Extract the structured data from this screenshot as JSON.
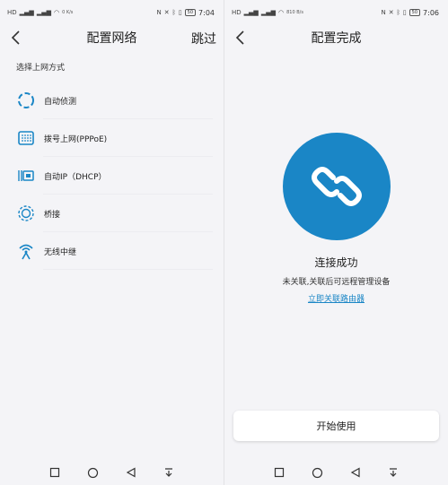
{
  "left": {
    "status": {
      "carrier": "HD",
      "speed": "0 K/s",
      "battery": "50",
      "time": "7:04"
    },
    "header": {
      "title": "配置网络",
      "skip": "跳过"
    },
    "section_label": "选择上网方式",
    "options": [
      {
        "label": "自动侦测",
        "icon": "auto-detect-icon"
      },
      {
        "label": "拨号上网(PPPoE)",
        "icon": "dialup-keypad-icon"
      },
      {
        "label": "自动IP（DHCP）",
        "icon": "dhcp-icon"
      },
      {
        "label": "桥接",
        "icon": "bridge-icon"
      },
      {
        "label": "无线中继",
        "icon": "wireless-relay-icon"
      }
    ]
  },
  "right": {
    "status": {
      "carrier": "HD",
      "speed": "810 B/s",
      "battery": "50",
      "time": "7:06"
    },
    "header": {
      "title": "配置完成"
    },
    "success": {
      "title": "连接成功",
      "desc": "未关联,关联后可远程管理设备",
      "link": "立即关联路由器"
    },
    "start_button": "开始使用"
  },
  "colors": {
    "accent": "#1a86c6",
    "background": "#f4f4f7"
  }
}
